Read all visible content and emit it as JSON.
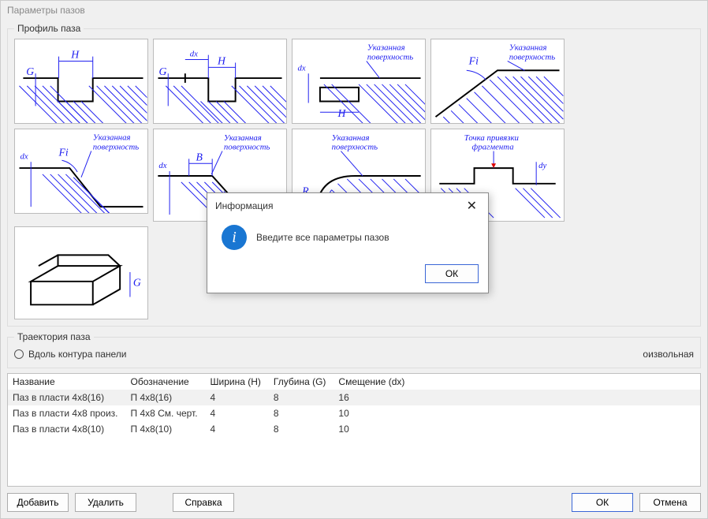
{
  "window": {
    "title": "Параметры пазов"
  },
  "sections": {
    "profile_legend": "Профиль паза",
    "trajectory_legend": "Траектория паза"
  },
  "profile_labels": {
    "G": "G",
    "H": "H",
    "dx": "dx",
    "B": "B",
    "R": "R",
    "dy": "dy",
    "Fi": "Fi",
    "surface": "Указанная",
    "surface2": "поверхность",
    "anchor1": "Точка привязки",
    "anchor2": "фрагмента"
  },
  "trajectory": {
    "opt_contour": "Вдоль контура панели",
    "opt_arbitrary": "оизвольная"
  },
  "table": {
    "headers": {
      "name": "Название",
      "designation": "Обозначение",
      "width": "Ширина (H)",
      "depth": "Глубина (G)",
      "offset": "Смещение (dx)"
    },
    "rows": [
      {
        "name": "Паз в пласти 4х8(16)",
        "designation": "П 4х8(16)",
        "width": "4",
        "depth": "8",
        "offset": "16",
        "selected": true
      },
      {
        "name": "Паз в пласти 4х8 произ.",
        "designation": "П 4х8 См. черт.",
        "width": "4",
        "depth": "8",
        "offset": "10",
        "selected": false
      },
      {
        "name": "Паз в пласти 4х8(10)",
        "designation": "П 4х8(10)",
        "width": "4",
        "depth": "8",
        "offset": "10",
        "selected": false
      }
    ]
  },
  "buttons": {
    "add": "Добавить",
    "delete": "Удалить",
    "help": "Справка",
    "ok": "ОК",
    "cancel": "Отмена"
  },
  "modal": {
    "title": "Информация",
    "message": "Введите все параметры пазов",
    "ok": "ОК"
  }
}
